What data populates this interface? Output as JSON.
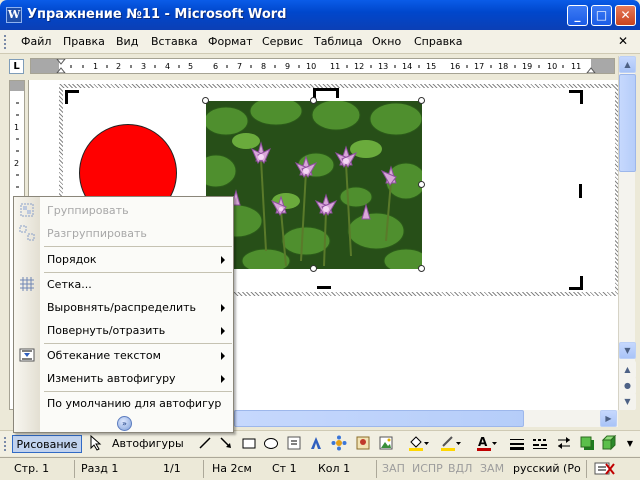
{
  "window": {
    "title": "Упражнение №11 - Microsoft Word",
    "app_icon": "W",
    "buttons": {
      "minimize": "_",
      "maximize": "□",
      "close": "✕"
    }
  },
  "menubar": {
    "items": [
      "Файл",
      "Правка",
      "Вид",
      "Вставка",
      "Формат",
      "Сервис",
      "Таблица",
      "Окно",
      "Справка"
    ],
    "close_doc": "✕"
  },
  "ruler": {
    "tab_glyph": "L"
  },
  "context_menu": {
    "items": [
      {
        "label": "Группировать",
        "disabled": true,
        "icon": "group-icon"
      },
      {
        "label": "Разгруппировать",
        "disabled": true,
        "icon": "ungroup-icon"
      },
      {
        "label": "Порядок",
        "submenu": true
      },
      {
        "label": "Сетка...",
        "icon": "grid-icon"
      },
      {
        "label": "Выровнять/распределить",
        "submenu": true
      },
      {
        "label": "Повернуть/отразить",
        "submenu": true
      },
      {
        "label": "Обтекание текстом",
        "submenu": true,
        "icon": "text-wrap-icon"
      },
      {
        "label": "Изменить автофигуру",
        "submenu": true
      },
      {
        "label": "По умолчанию для автофигур"
      }
    ],
    "more_glyph": "»"
  },
  "drawing_toolbar": {
    "drawing_label": "Рисование ▾",
    "autoshapes_label": "Автофигуры ▾",
    "tools": [
      "select-arrow-icon",
      "line-icon",
      "arrow-icon",
      "rectangle-icon",
      "oval-icon",
      "textbox-icon",
      "wordart-icon",
      "diagram-icon",
      "clipart-icon",
      "picture-icon",
      "fill-color-icon",
      "line-color-icon",
      "font-color-icon",
      "line-style-icon",
      "dash-style-icon",
      "arrow-style-icon",
      "shadow-icon",
      "3d-icon"
    ]
  },
  "status_bar": {
    "page": "Стр.  1",
    "section": "Разд  1",
    "pages": "1/1",
    "at": "На  2см",
    "line": "Ст  1",
    "col": "Кол  1",
    "rec": "ЗАП",
    "trk": "ИСПР",
    "ext": "ВДЛ",
    "ovr": "ЗАМ",
    "language": "русский (Ро"
  },
  "colors": {
    "circle": "#ff0000",
    "titlebar": "#0a5ce8",
    "selection": "#316ac5"
  }
}
